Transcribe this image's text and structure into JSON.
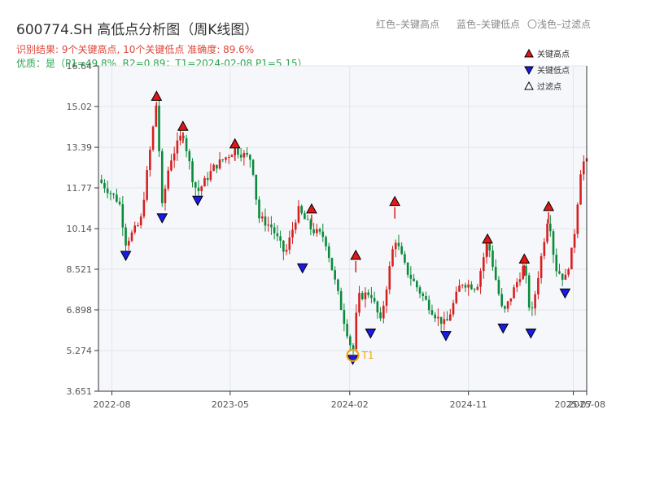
{
  "header": {
    "title": "600774.SH 高低点分析图（周K线图）",
    "result_line": "识别结果: 9个关键高点, 10个关键低点  准确度: 89.6%",
    "quality_line": "优质：是（P1=49.8%, R2=0.89；T1=2024-02-08 P1=5.15）"
  },
  "top_legend": {
    "red": "红色–关键高点",
    "blue": "蓝色–关键低点",
    "light": "〇浅色–过滤点"
  },
  "colors": {
    "up": "#d62020",
    "down": "#0a8a3a",
    "high_marker": "#e11616",
    "low_marker": "#1a1ae6",
    "t1": "#f5a000",
    "plot_bg": "#f5f7fa"
  },
  "chart_data": {
    "type": "candlestick",
    "title": "600774.SH 高低点分析图（周K线图）",
    "xlabel": "",
    "ylabel": "",
    "x_range": [
      "2022-07-01",
      "2025-08-01"
    ],
    "ylim": [
      3.651,
      16.64
    ],
    "yticks": [
      3.651,
      5.274,
      6.898,
      8.521,
      10.14,
      11.77,
      13.39,
      15.02,
      16.64
    ],
    "ytick_labels": [
      "3.651",
      "5.274",
      "6.898",
      "8.521",
      "10.14",
      "11.77",
      "13.39",
      "15.02",
      "16.64"
    ],
    "xticks": [
      "2022-08-01",
      "2023-05-01",
      "2024-02-01",
      "2024-11-01",
      "2025-07-01",
      "2025-08-01"
    ],
    "xtick_labels": [
      "2022-08",
      "2023-05",
      "2024-02",
      "2024-11",
      "2025-07",
      "2025-08"
    ],
    "price_anchors": [
      [
        "2022-07-01",
        12.1
      ],
      [
        "2022-08-18",
        11.2
      ],
      [
        "2022-09-02",
        9.6
      ],
      [
        "2022-10-06",
        10.4
      ],
      [
        "2022-11-12",
        15.2
      ],
      [
        "2022-11-25",
        11.0
      ],
      [
        "2022-12-12",
        12.8
      ],
      [
        "2023-01-12",
        14.0
      ],
      [
        "2023-02-05",
        12.0
      ],
      [
        "2023-02-15",
        11.6
      ],
      [
        "2023-03-25",
        12.6
      ],
      [
        "2023-05-12",
        13.3
      ],
      [
        "2023-06-20",
        12.9
      ],
      [
        "2023-07-05",
        10.6
      ],
      [
        "2023-08-05",
        10.2
      ],
      [
        "2023-09-05",
        9.1
      ],
      [
        "2023-10-05",
        10.9
      ],
      [
        "2023-11-05",
        10.1
      ],
      [
        "2023-12-05",
        9.8
      ],
      [
        "2024-01-20",
        6.4
      ],
      [
        "2024-02-08",
        5.15
      ],
      [
        "2024-02-20",
        7.4
      ],
      [
        "2024-03-20",
        7.6
      ],
      [
        "2024-04-12",
        6.4
      ],
      [
        "2024-05-15",
        9.8
      ],
      [
        "2024-06-10",
        8.5
      ],
      [
        "2024-07-20",
        7.4
      ],
      [
        "2024-08-20",
        6.6
      ],
      [
        "2024-09-10",
        6.3
      ],
      [
        "2024-10-15",
        8.0
      ],
      [
        "2024-11-20",
        7.8
      ],
      [
        "2024-12-15",
        9.7
      ],
      [
        "2025-01-20",
        6.7
      ],
      [
        "2025-03-10",
        8.7
      ],
      [
        "2025-03-25",
        6.5
      ],
      [
        "2025-05-05",
        10.8
      ],
      [
        "2025-05-20",
        8.6
      ],
      [
        "2025-06-12",
        8.1
      ],
      [
        "2025-07-01",
        9.5
      ],
      [
        "2025-07-20",
        12.8
      ]
    ],
    "key_highs": [
      {
        "date": "2022-11-12",
        "price": 15.2
      },
      {
        "date": "2023-01-12",
        "price": 14.0
      },
      {
        "date": "2023-05-12",
        "price": 13.3
      },
      {
        "date": "2023-11-05",
        "price": 10.7
      },
      {
        "date": "2024-02-15",
        "price": 8.85
      },
      {
        "date": "2024-05-15",
        "price": 11.0
      },
      {
        "date": "2024-12-15",
        "price": 9.5
      },
      {
        "date": "2025-03-10",
        "price": 8.7
      },
      {
        "date": "2025-05-05",
        "price": 10.8
      }
    ],
    "key_lows": [
      {
        "date": "2022-09-02",
        "price": 9.3
      },
      {
        "date": "2022-11-25",
        "price": 10.8
      },
      {
        "date": "2023-02-15",
        "price": 11.5
      },
      {
        "date": "2023-10-15",
        "price": 8.8
      },
      {
        "date": "2024-02-08",
        "price": 5.15
      },
      {
        "date": "2024-03-20",
        "price": 6.2
      },
      {
        "date": "2024-09-10",
        "price": 6.1
      },
      {
        "date": "2025-01-20",
        "price": 6.4
      },
      {
        "date": "2025-03-25",
        "price": 6.2
      },
      {
        "date": "2025-06-12",
        "price": 7.8
      }
    ],
    "t1": {
      "label": "T1",
      "date": "2024-02-08",
      "price": 5.15
    },
    "legend": [
      {
        "label": "关键高点",
        "marker": "triangle-up",
        "color": "#e11616"
      },
      {
        "label": "关键低点",
        "marker": "triangle-down",
        "color": "#1a1ae6"
      },
      {
        "label": "过滤点",
        "marker": "triangle-up-outline",
        "color": "#ffffff"
      }
    ],
    "grid": true
  }
}
